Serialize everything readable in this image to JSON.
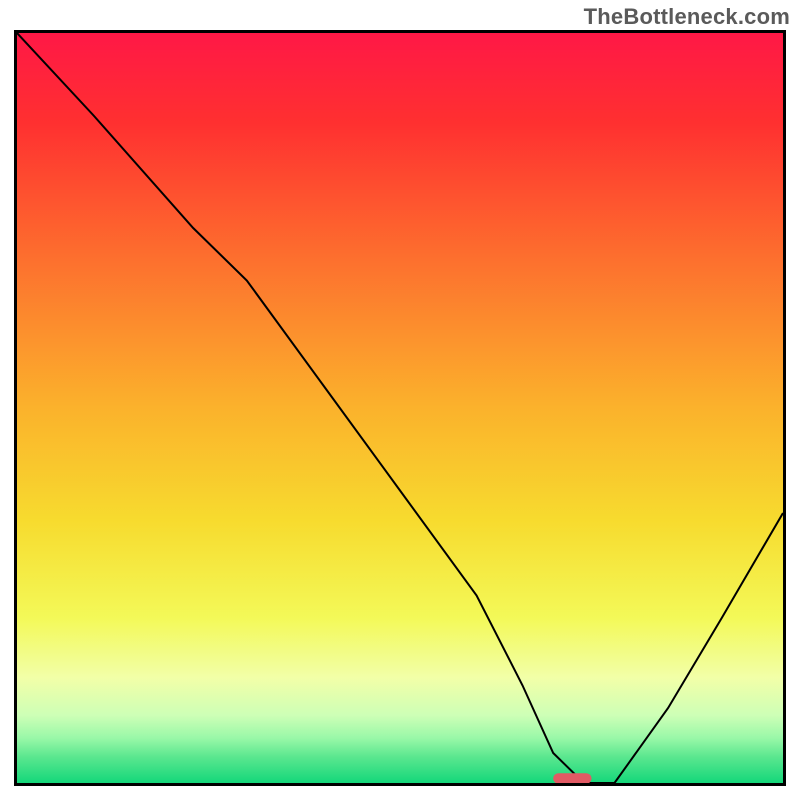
{
  "watermark": "TheBottleneck.com",
  "chart_data": {
    "type": "line",
    "title": "",
    "xlabel": "",
    "ylabel": "",
    "xlim": [
      0,
      100
    ],
    "ylim": [
      0,
      100
    ],
    "grid": false,
    "background_gradient_stops": [
      {
        "offset": 0.0,
        "color": "#ff1846"
      },
      {
        "offset": 0.12,
        "color": "#ff3030"
      },
      {
        "offset": 0.3,
        "color": "#fd6f2e"
      },
      {
        "offset": 0.5,
        "color": "#fbb22c"
      },
      {
        "offset": 0.65,
        "color": "#f7db2e"
      },
      {
        "offset": 0.78,
        "color": "#f3f958"
      },
      {
        "offset": 0.86,
        "color": "#f2ffa8"
      },
      {
        "offset": 0.91,
        "color": "#cdffb6"
      },
      {
        "offset": 0.94,
        "color": "#99f8a8"
      },
      {
        "offset": 0.965,
        "color": "#5be78f"
      },
      {
        "offset": 1.0,
        "color": "#14d77a"
      }
    ],
    "series": [
      {
        "name": "bottleneck-curve",
        "stroke": "#000000",
        "stroke_width": 2,
        "x": [
          0,
          10,
          23,
          30,
          40,
          50,
          60,
          66,
          70,
          74,
          78,
          85,
          92,
          100
        ],
        "y": [
          100,
          89,
          74,
          67,
          53,
          39,
          25,
          13,
          4,
          0,
          0,
          10,
          22,
          36
        ]
      }
    ],
    "marker": {
      "name": "optimal-point",
      "x": 72.5,
      "y": 0.6,
      "width_pct": 5,
      "height_pct": 1.4,
      "color": "#e15a64"
    }
  }
}
